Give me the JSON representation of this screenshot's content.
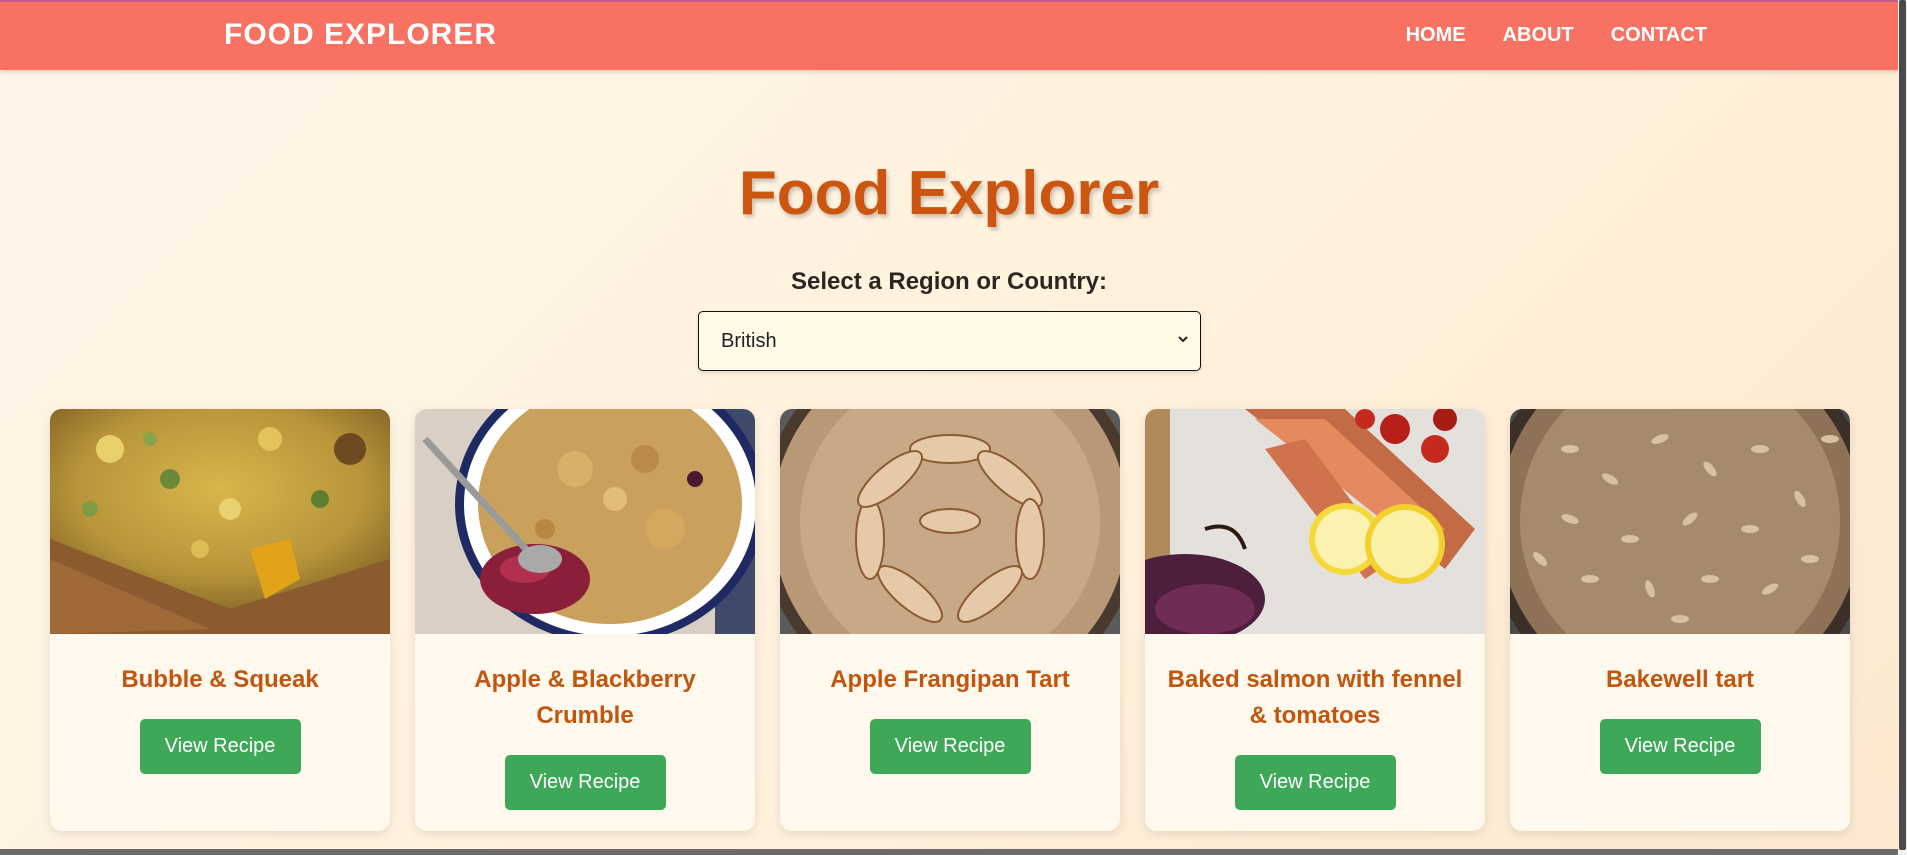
{
  "navbar": {
    "brand": "FOOD EXPLORER",
    "links": [
      "HOME",
      "ABOUT",
      "CONTACT"
    ]
  },
  "main": {
    "title": "Food Explorer",
    "select_label": "Select a Region or Country:",
    "selected_region": "British"
  },
  "recipes": [
    {
      "title": "Bubble & Squeak",
      "button": "View Recipe",
      "image": "bubble-and-squeak-photo"
    },
    {
      "title": "Apple & Blackberry Crumble",
      "button": "View Recipe",
      "image": "crumble-photo"
    },
    {
      "title": "Apple Frangipan Tart",
      "button": "View Recipe",
      "image": "apple-tart-photo"
    },
    {
      "title": "Baked salmon with fennel & tomatoes",
      "button": "View Recipe",
      "image": "salmon-photo"
    },
    {
      "title": "Bakewell tart",
      "button": "View Recipe",
      "image": "bakewell-tart-photo"
    }
  ],
  "colors": {
    "navbar": "#f87263",
    "title": "#cc5510",
    "card_title": "#c0560f",
    "button": "#3fa758",
    "card_bg": "#fff8ec"
  }
}
